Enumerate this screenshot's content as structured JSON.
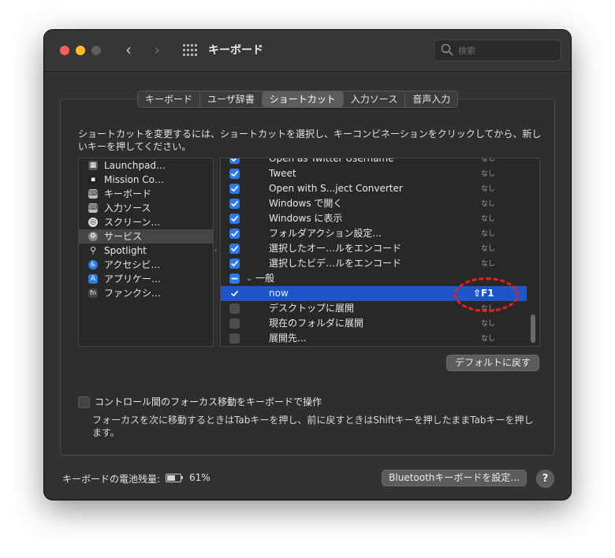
{
  "window": {
    "title": "キーボード"
  },
  "search": {
    "placeholder": "検索"
  },
  "tabs": [
    {
      "label": "キーボード"
    },
    {
      "label": "ユーザ辞書"
    },
    {
      "label": "ショートカット",
      "active": true
    },
    {
      "label": "入力ソース"
    },
    {
      "label": "音声入力"
    }
  ],
  "description": "ショートカットを変更するには、ショートカットを選択し、キーコンビネーションをクリックしてから、新しいキーを押してください。",
  "categories": [
    {
      "label": "Launchpad…",
      "icon": "launchpad-icon"
    },
    {
      "label": "Mission Co…",
      "icon": "mission-control-icon"
    },
    {
      "label": "キーボード",
      "icon": "keyboard-icon"
    },
    {
      "label": "入力ソース",
      "icon": "input-source-icon"
    },
    {
      "label": "スクリーン…",
      "icon": "screenshot-icon"
    },
    {
      "label": "サービス",
      "icon": "gear-icon",
      "selected": true
    },
    {
      "label": "Spotlight",
      "icon": "spotlight-icon"
    },
    {
      "label": "アクセシビ…",
      "icon": "accessibility-icon"
    },
    {
      "label": "アプリケー…",
      "icon": "app-store-icon"
    },
    {
      "label": "ファンクシ…",
      "icon": "fn-icon"
    }
  ],
  "shortcuts": [
    {
      "label": "Open as Twitter Username",
      "key": "なし",
      "state": "on"
    },
    {
      "label": "Tweet",
      "key": "なし",
      "state": "on"
    },
    {
      "label": "Open with S...ject Converter",
      "key": "なし",
      "state": "on"
    },
    {
      "label": "Windows で開く",
      "key": "なし",
      "state": "on"
    },
    {
      "label": "Windows に表示",
      "key": "なし",
      "state": "on"
    },
    {
      "label": "フォルダアクション設定...",
      "key": "なし",
      "state": "on"
    },
    {
      "label": "選択したオー…ルをエンコード",
      "key": "なし",
      "state": "on"
    },
    {
      "label": "選択したビデ…ルをエンコード",
      "key": "なし",
      "state": "on"
    },
    {
      "label": "一般",
      "key": "",
      "state": "mixed",
      "group": true
    },
    {
      "label": "now",
      "key": "⇧F1",
      "state": "on",
      "selected": true
    },
    {
      "label": "デスクトップに展開",
      "key": "なし",
      "state": "off"
    },
    {
      "label": "現在のフォルダに展開",
      "key": "なし",
      "state": "off"
    },
    {
      "label": "展開先...",
      "key": "なし",
      "state": "off"
    }
  ],
  "buttons": {
    "restore_defaults": "デフォルトに戻す",
    "bluetooth_setup": "Bluetoothキーボードを設定...",
    "help": "?"
  },
  "focus_option": {
    "label": "コントロール間のフォーカス移動をキーボードで操作",
    "checked": false,
    "help": "フォーカスを次に移動するときはTabキーを押し、前に戻すときはShiftキーを押したままTabキーを押します。"
  },
  "battery": {
    "label": "キーボードの電池残量:",
    "percent": "61%",
    "level": 0.61
  },
  "colors": {
    "accent": "#2f78e8",
    "selection": "#1e55c8",
    "annotation": "#e5221c"
  }
}
